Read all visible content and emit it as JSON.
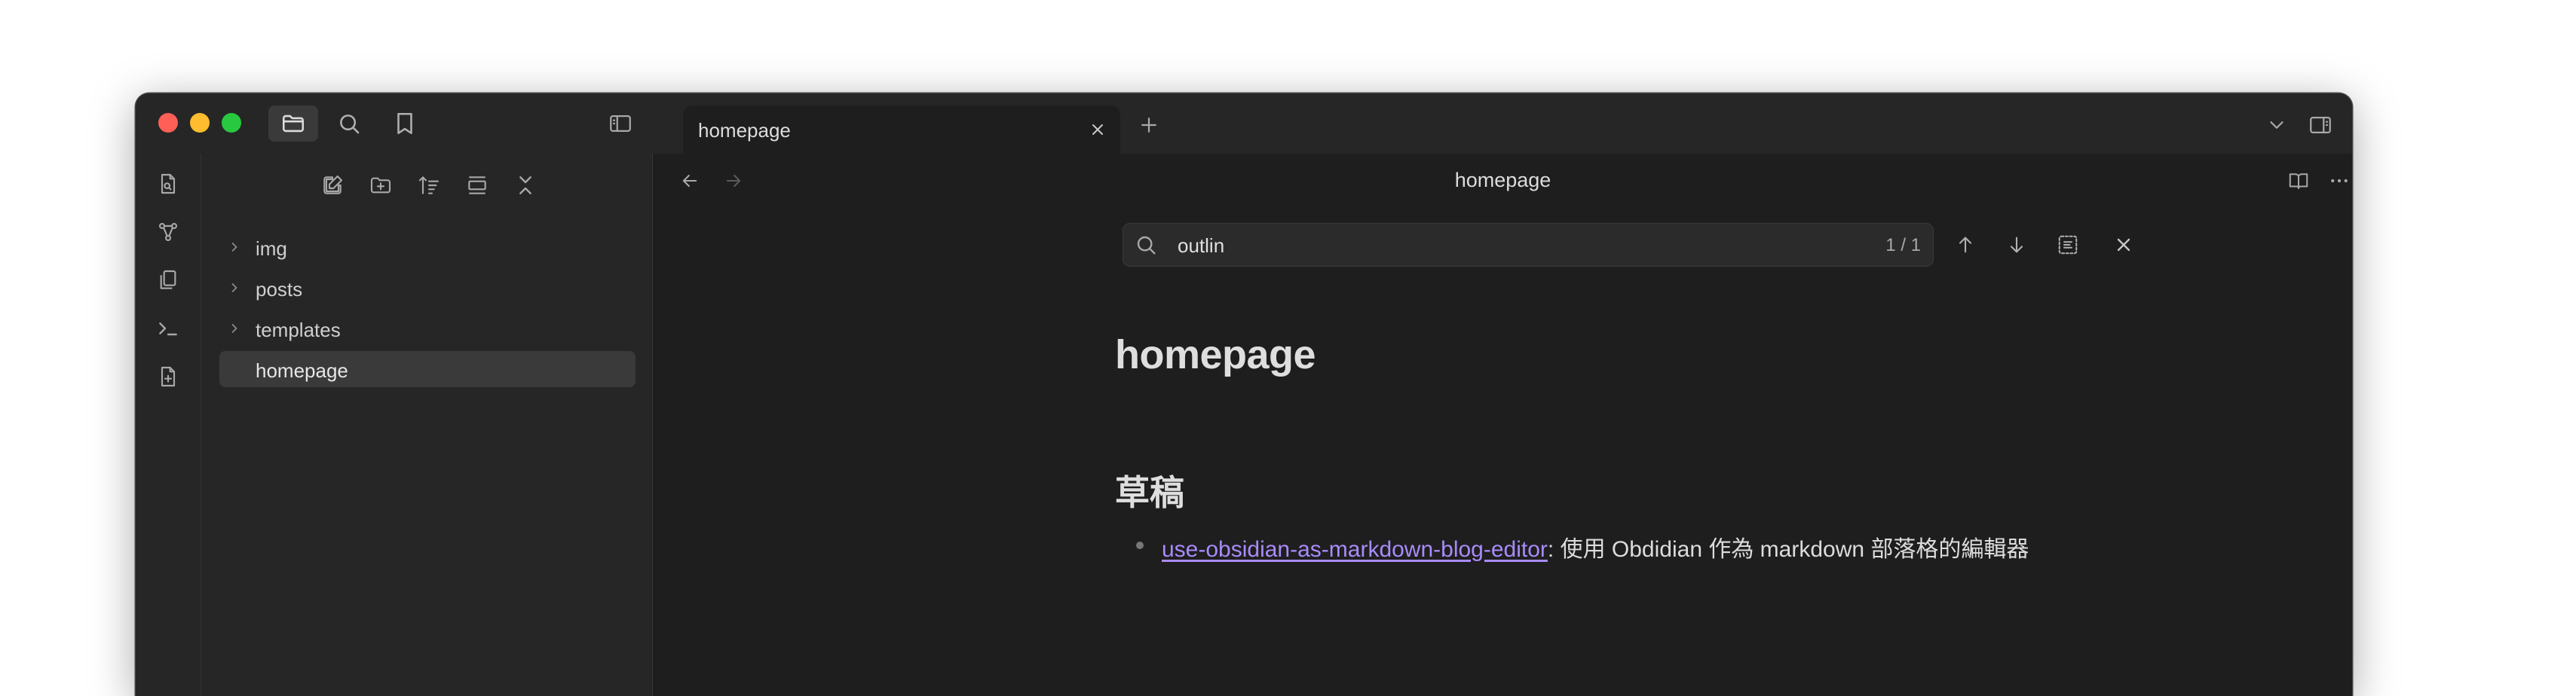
{
  "tab": {
    "title": "homepage"
  },
  "explorer": {
    "items": [
      {
        "label": "img",
        "type": "folder"
      },
      {
        "label": "posts",
        "type": "folder"
      },
      {
        "label": "templates",
        "type": "folder"
      },
      {
        "label": "homepage",
        "type": "file",
        "selected": true
      }
    ]
  },
  "view": {
    "title": "homepage"
  },
  "search": {
    "value": "outlin",
    "count": "1 / 1"
  },
  "document": {
    "title": "homepage",
    "heading": "草稿",
    "items": [
      {
        "link_text": "use-obsidian-as-markdown-blog-editor",
        "rest_text": ": 使用 Obdidian 作為 markdown 部落格的編輯器"
      }
    ]
  },
  "colors": {
    "accent_link": "#a88bfa",
    "background": "#1e1e1e",
    "sidebar": "#262626"
  }
}
